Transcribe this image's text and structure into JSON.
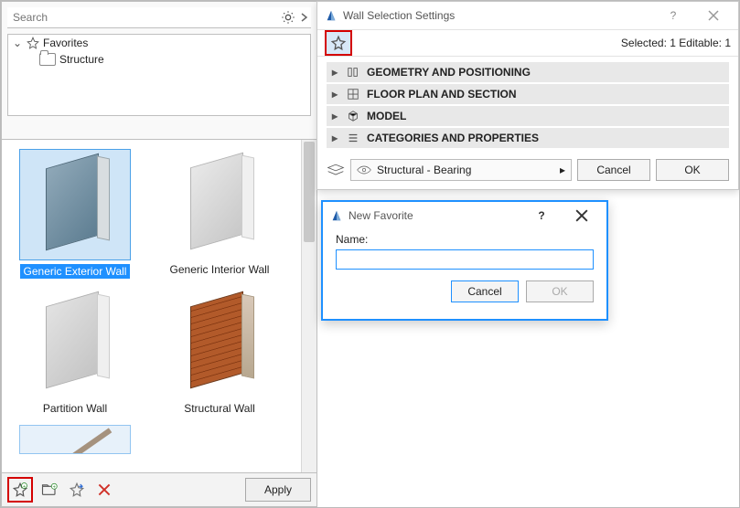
{
  "palette": {
    "search_placeholder": "Search",
    "tree": {
      "root": "Favorites",
      "child": "Structure"
    },
    "items": [
      {
        "label": "Generic Exterior Wall",
        "selected": true
      },
      {
        "label": "Generic Interior Wall",
        "selected": false
      },
      {
        "label": "Partition Wall",
        "selected": false
      },
      {
        "label": "Structural Wall",
        "selected": false
      }
    ],
    "apply_label": "Apply"
  },
  "settings": {
    "title": "Wall Selection Settings",
    "selection_text": "Selected: 1 Editable: 1",
    "sections": [
      "GEOMETRY AND POSITIONING",
      "FLOOR PLAN AND SECTION",
      "MODEL",
      "CATEGORIES AND PROPERTIES"
    ],
    "layer": "Structural - Bearing",
    "cancel_label": "Cancel",
    "ok_label": "OK"
  },
  "dialog": {
    "title": "New Favorite",
    "name_label": "Name:",
    "name_value": "",
    "cancel_label": "Cancel",
    "ok_label": "OK"
  }
}
